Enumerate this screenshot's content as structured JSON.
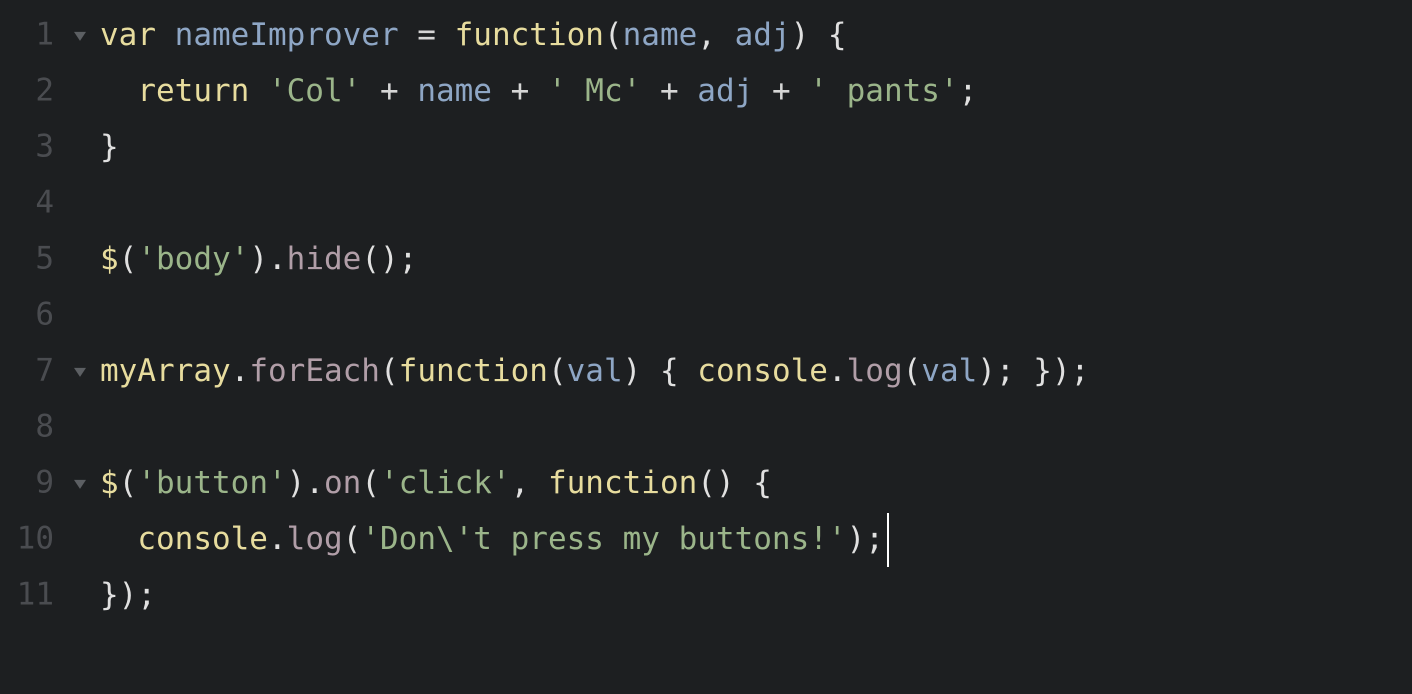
{
  "editor": {
    "theme": {
      "background": "#1d1f21",
      "line_number": "#4a4c50",
      "keyword": "#e7dc9e",
      "variable": "#8ea6c5",
      "string": "#9bb58a",
      "property": "#b19ea8",
      "punctuation": "#e0e0e0"
    },
    "cursor": {
      "line": 10
    },
    "lines": [
      {
        "number": "1",
        "foldable": true,
        "tokens": [
          {
            "t": "var",
            "c": "kw"
          },
          {
            "t": " ",
            "c": "op"
          },
          {
            "t": "nameImprover",
            "c": "var"
          },
          {
            "t": " = ",
            "c": "op"
          },
          {
            "t": "function",
            "c": "fn"
          },
          {
            "t": "(",
            "c": "punc"
          },
          {
            "t": "name",
            "c": "var"
          },
          {
            "t": ", ",
            "c": "punc"
          },
          {
            "t": "adj",
            "c": "var"
          },
          {
            "t": ") {",
            "c": "punc"
          }
        ]
      },
      {
        "number": "2",
        "foldable": false,
        "tokens": [
          {
            "t": "  ",
            "c": "op"
          },
          {
            "t": "return",
            "c": "kw"
          },
          {
            "t": " ",
            "c": "op"
          },
          {
            "t": "'Col'",
            "c": "str"
          },
          {
            "t": " + ",
            "c": "op"
          },
          {
            "t": "name",
            "c": "var"
          },
          {
            "t": " + ",
            "c": "op"
          },
          {
            "t": "' Mc'",
            "c": "str"
          },
          {
            "t": " + ",
            "c": "op"
          },
          {
            "t": "adj",
            "c": "var"
          },
          {
            "t": " + ",
            "c": "op"
          },
          {
            "t": "' pants'",
            "c": "str"
          },
          {
            "t": ";",
            "c": "punc"
          }
        ]
      },
      {
        "number": "3",
        "foldable": false,
        "tokens": [
          {
            "t": "}",
            "c": "punc"
          }
        ]
      },
      {
        "number": "4",
        "foldable": false,
        "tokens": []
      },
      {
        "number": "5",
        "foldable": false,
        "tokens": [
          {
            "t": "$",
            "c": "dollar"
          },
          {
            "t": "(",
            "c": "punc"
          },
          {
            "t": "'body'",
            "c": "str"
          },
          {
            "t": ").",
            "c": "punc"
          },
          {
            "t": "hide",
            "c": "prop"
          },
          {
            "t": "();",
            "c": "punc"
          }
        ]
      },
      {
        "number": "6",
        "foldable": false,
        "tokens": []
      },
      {
        "number": "7",
        "foldable": true,
        "tokens": [
          {
            "t": "myArray",
            "c": "kw"
          },
          {
            "t": ".",
            "c": "punc"
          },
          {
            "t": "forEach",
            "c": "prop"
          },
          {
            "t": "(",
            "c": "punc"
          },
          {
            "t": "function",
            "c": "fn"
          },
          {
            "t": "(",
            "c": "punc"
          },
          {
            "t": "val",
            "c": "var"
          },
          {
            "t": ") { ",
            "c": "punc"
          },
          {
            "t": "console",
            "c": "kw"
          },
          {
            "t": ".",
            "c": "punc"
          },
          {
            "t": "log",
            "c": "prop"
          },
          {
            "t": "(",
            "c": "punc"
          },
          {
            "t": "val",
            "c": "var"
          },
          {
            "t": "); });",
            "c": "punc"
          }
        ]
      },
      {
        "number": "8",
        "foldable": false,
        "tokens": []
      },
      {
        "number": "9",
        "foldable": true,
        "tokens": [
          {
            "t": "$",
            "c": "dollar"
          },
          {
            "t": "(",
            "c": "punc"
          },
          {
            "t": "'button'",
            "c": "str"
          },
          {
            "t": ").",
            "c": "punc"
          },
          {
            "t": "on",
            "c": "prop"
          },
          {
            "t": "(",
            "c": "punc"
          },
          {
            "t": "'click'",
            "c": "str"
          },
          {
            "t": ", ",
            "c": "punc"
          },
          {
            "t": "function",
            "c": "fn"
          },
          {
            "t": "() {",
            "c": "punc"
          }
        ]
      },
      {
        "number": "10",
        "foldable": false,
        "tokens": [
          {
            "t": "  ",
            "c": "op"
          },
          {
            "t": "console",
            "c": "kw"
          },
          {
            "t": ".",
            "c": "punc"
          },
          {
            "t": "log",
            "c": "prop"
          },
          {
            "t": "(",
            "c": "punc"
          },
          {
            "t": "'Don\\'t press my buttons!'",
            "c": "str"
          },
          {
            "t": ");",
            "c": "punc"
          }
        ]
      },
      {
        "number": "11",
        "foldable": false,
        "tokens": [
          {
            "t": "});",
            "c": "punc"
          }
        ]
      }
    ]
  }
}
